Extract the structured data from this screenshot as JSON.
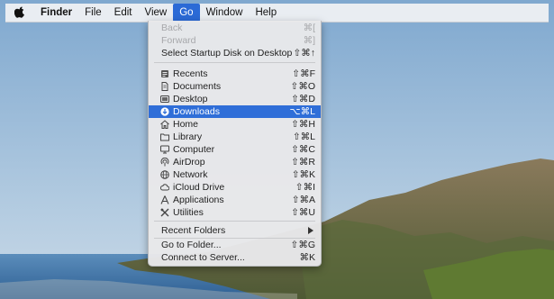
{
  "menubar": {
    "apple_icon": "apple-logo-icon",
    "items": [
      "Finder",
      "File",
      "Edit",
      "View",
      "Go",
      "Window",
      "Help"
    ],
    "active": "Go"
  },
  "go_menu": {
    "top": [
      {
        "label": "Back",
        "shortcut": "⌘[",
        "enabled": false
      },
      {
        "label": "Forward",
        "shortcut": "⌘]",
        "enabled": false
      },
      {
        "label": "Select Startup Disk on Desktop",
        "shortcut": "⇧⌘↑",
        "enabled": true
      }
    ],
    "places": [
      {
        "label": "Recents",
        "shortcut": "⇧⌘F",
        "icon": "recents-icon"
      },
      {
        "label": "Documents",
        "shortcut": "⇧⌘O",
        "icon": "documents-icon"
      },
      {
        "label": "Desktop",
        "shortcut": "⇧⌘D",
        "icon": "desktop-icon"
      },
      {
        "label": "Downloads",
        "shortcut": "⌥⌘L",
        "icon": "downloads-icon",
        "highlighted": true
      },
      {
        "label": "Home",
        "shortcut": "⇧⌘H",
        "icon": "home-icon"
      },
      {
        "label": "Library",
        "shortcut": "⇧⌘L",
        "icon": "library-icon"
      },
      {
        "label": "Computer",
        "shortcut": "⇧⌘C",
        "icon": "computer-icon"
      },
      {
        "label": "AirDrop",
        "shortcut": "⇧⌘R",
        "icon": "airdrop-icon"
      },
      {
        "label": "Network",
        "shortcut": "⇧⌘K",
        "icon": "network-icon"
      },
      {
        "label": "iCloud Drive",
        "shortcut": "⇧⌘I",
        "icon": "icloud-icon"
      },
      {
        "label": "Applications",
        "shortcut": "⇧⌘A",
        "icon": "applications-icon"
      },
      {
        "label": "Utilities",
        "shortcut": "⇧⌘U",
        "icon": "utilities-icon"
      }
    ],
    "recent_folders": {
      "label": "Recent Folders",
      "icon": "submenu-arrow-icon"
    },
    "bottom": [
      {
        "label": "Go to Folder...",
        "shortcut": "⇧⌘G"
      },
      {
        "label": "Connect to Server...",
        "shortcut": "⌘K"
      }
    ]
  },
  "colors": {
    "highlight": "#2f6ed8",
    "menubar_active": "#2b6ad6",
    "sky": "#9cbcd8",
    "sea": "#4a7fb0"
  }
}
